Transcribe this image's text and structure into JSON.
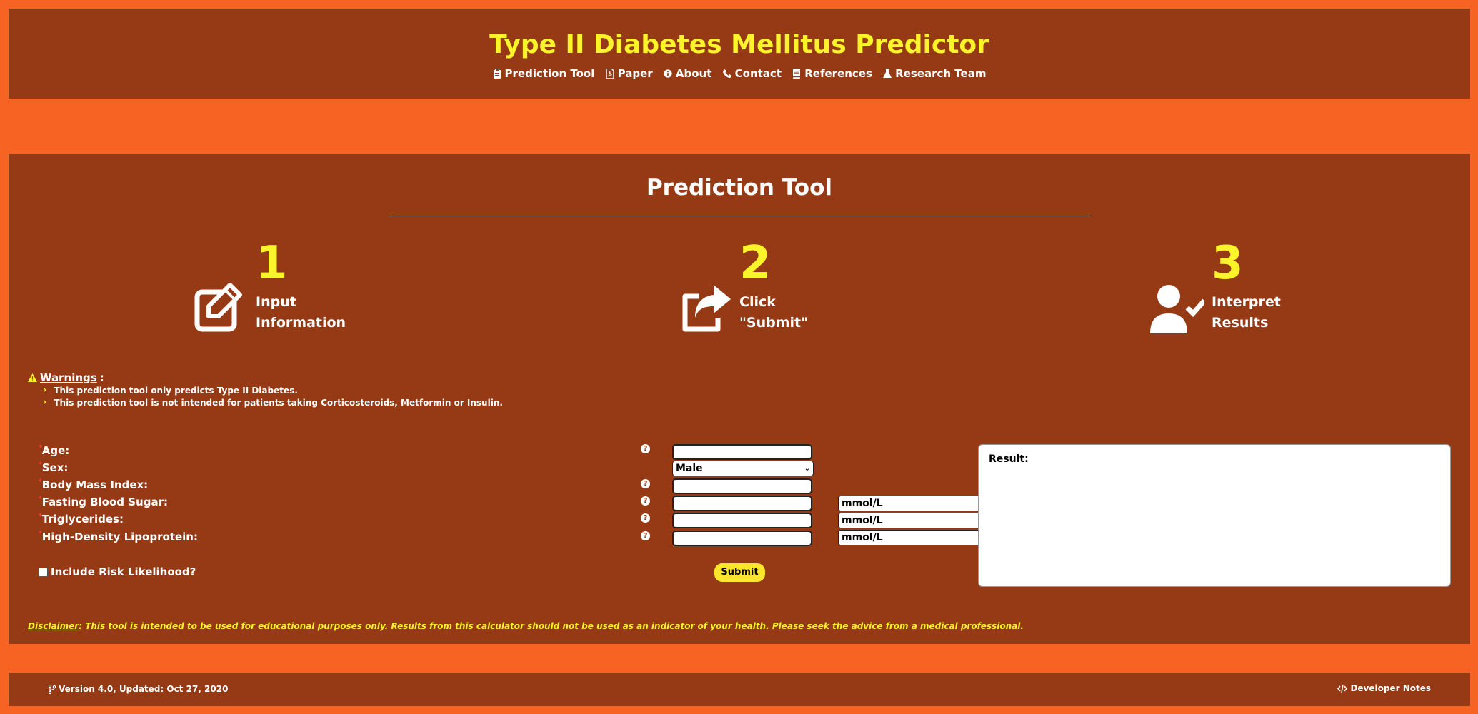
{
  "header": {
    "title": "Type II Diabetes Mellitus Predictor",
    "nav": [
      {
        "label": "Prediction Tool",
        "icon": "clipboard-icon"
      },
      {
        "label": "Paper",
        "icon": "file-pdf-icon"
      },
      {
        "label": "About",
        "icon": "info-circle-icon"
      },
      {
        "label": "Contact",
        "icon": "phone-icon"
      },
      {
        "label": "References",
        "icon": "book-icon"
      },
      {
        "label": "Research Team",
        "icon": "flask-icon"
      }
    ]
  },
  "main": {
    "title": "Prediction Tool",
    "steps": [
      {
        "number": "1",
        "line1": "Input",
        "line2": "Information",
        "icon": "edit-icon"
      },
      {
        "number": "2",
        "line1": "Click",
        "line2": "\"Submit\"",
        "icon": "share-icon"
      },
      {
        "number": "3",
        "line1": "Interpret",
        "line2": "Results",
        "icon": "user-check-icon"
      }
    ],
    "warnings": {
      "heading": "Warnings",
      "colon": ":",
      "items": [
        "This prediction tool only predicts Type II Diabetes.",
        "This prediction tool is not intended for patients taking Corticosteroids, Metformin or Insulin."
      ]
    },
    "form": {
      "required_mark": "*",
      "fields": [
        {
          "label": "Age:",
          "value": ""
        },
        {
          "label": "Sex:",
          "value": "Male"
        },
        {
          "label": "Body Mass Index:",
          "value": ""
        },
        {
          "label": "Fasting Blood Sugar:",
          "value": "",
          "unit": "mmol/L"
        },
        {
          "label": "Triglycerides:",
          "value": "",
          "unit": "mmol/L"
        },
        {
          "label": "High-Density Lipoprotein:",
          "value": "",
          "unit": "mmol/L"
        }
      ],
      "checkbox_label": "Include Risk Likelihood?",
      "submit_label": "Submit",
      "result_label": "Result:"
    },
    "disclaimer": {
      "label": "Disclaimer",
      "text": ": This tool is intended to be used for educational purposes only. Results from this calculator should not be used as an indicator of your health. Please seek the advice from a medical professional."
    }
  },
  "footer": {
    "version": "Version 4.0, Updated: Oct 27, 2020",
    "dev_notes": "Developer Notes"
  },
  "colors": {
    "page_bg": "#f76322",
    "panel_bg": "#953a15",
    "accent_yellow": "#fbf42a",
    "button_yellow": "#fbe62c"
  }
}
